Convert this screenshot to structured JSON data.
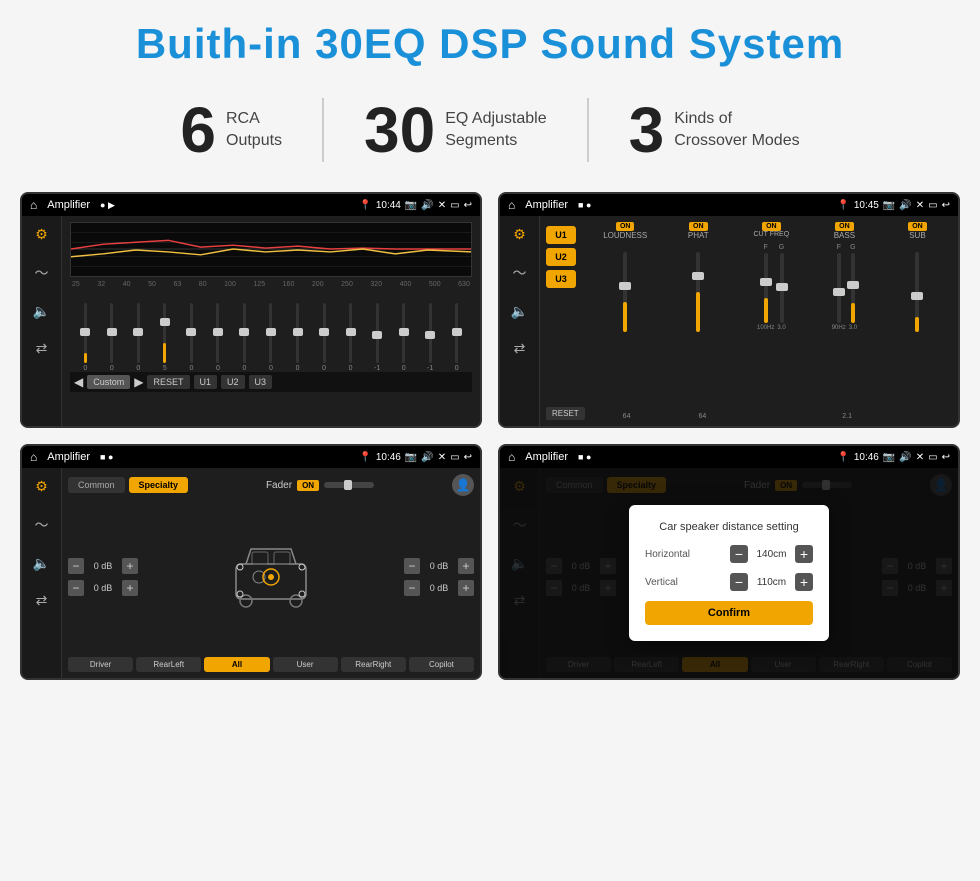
{
  "page": {
    "title": "Buith-in 30EQ DSP Sound System",
    "features": [
      {
        "number": "6",
        "label": "RCA\nOutputs"
      },
      {
        "number": "30",
        "label": "EQ Adjustable\nSegments"
      },
      {
        "number": "3",
        "label": "Kinds of\nCrossover Modes"
      }
    ]
  },
  "screens": {
    "eq": {
      "title": "Amplifier",
      "time": "10:44",
      "freqs": [
        "25",
        "32",
        "40",
        "50",
        "63",
        "80",
        "100",
        "125",
        "160",
        "200",
        "250",
        "320",
        "400",
        "500",
        "630"
      ],
      "values": [
        "0",
        "0",
        "0",
        "5",
        "0",
        "0",
        "0",
        "0",
        "0",
        "0",
        "0",
        "-1",
        "0",
        "-1"
      ],
      "preset": "Custom",
      "buttons": [
        "RESET",
        "U1",
        "U2",
        "U3"
      ]
    },
    "crossover": {
      "title": "Amplifier",
      "time": "10:45",
      "presets": [
        "U1",
        "U2",
        "U3"
      ],
      "channels": [
        "LOUDNESS",
        "PHAT",
        "CUT FREQ",
        "BASS",
        "SUB"
      ],
      "reset_label": "RESET"
    },
    "speaker": {
      "title": "Amplifier",
      "time": "10:46",
      "tabs": [
        "Common",
        "Specialty"
      ],
      "fader_label": "Fader",
      "fader_on": "ON",
      "db_values": [
        "0 dB",
        "0 dB",
        "0 dB",
        "0 dB"
      ],
      "buttons": [
        "Driver",
        "RearLeft",
        "All",
        "User",
        "RearRight",
        "Copilot"
      ]
    },
    "dialog": {
      "title": "Amplifier",
      "time": "10:46",
      "dialog_title": "Car speaker distance setting",
      "horizontal_label": "Horizontal",
      "horizontal_value": "140cm",
      "vertical_label": "Vertical",
      "vertical_value": "110cm",
      "confirm_label": "Confirm",
      "db_values": [
        "0 dB",
        "0 dB"
      ]
    }
  }
}
